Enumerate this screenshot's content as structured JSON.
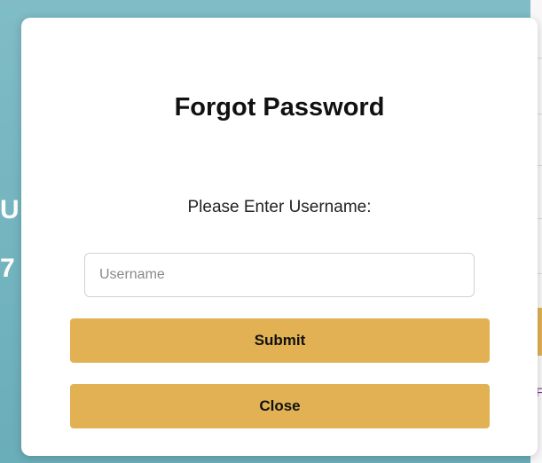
{
  "background": {
    "letters": [
      "U",
      "7"
    ],
    "partial_text": "F",
    "colors": {
      "teal": "#6aaeb9",
      "gold": "#e1b153",
      "purple_text": "#7a3d9a"
    }
  },
  "modal": {
    "title": "Forgot Password",
    "prompt": "Please Enter Username:",
    "username": {
      "placeholder": "Username",
      "value": ""
    },
    "buttons": {
      "submit_label": "Submit",
      "close_label": "Close"
    },
    "colors": {
      "button_bg": "#e1b153",
      "panel_bg": "#ffffff"
    }
  }
}
